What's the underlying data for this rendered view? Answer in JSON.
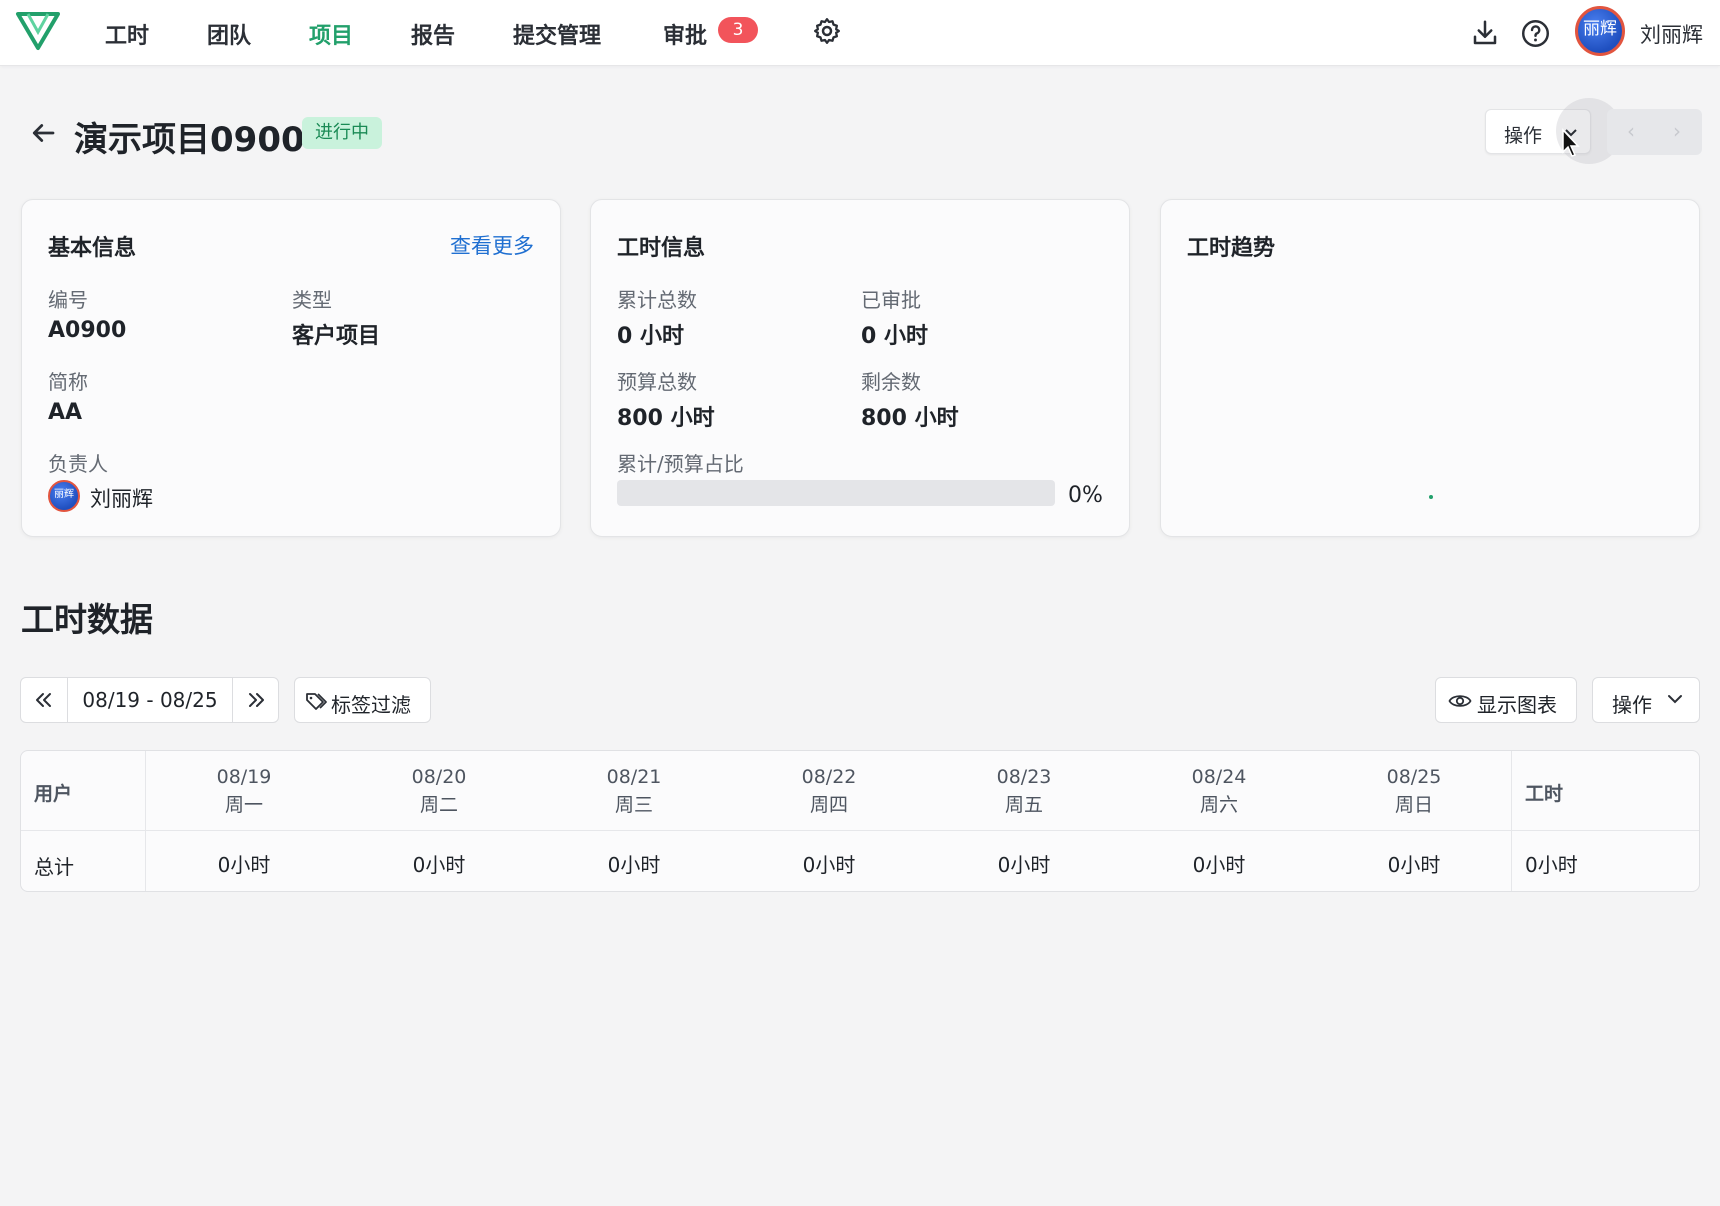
{
  "nav": {
    "items": [
      "工时",
      "团队",
      "项目",
      "报告",
      "提交管理",
      "审批"
    ],
    "active_index": 2,
    "approval_badge": "3",
    "user": {
      "avatar_text": "丽辉",
      "name": "刘丽辉"
    },
    "icons": [
      "logo",
      "settings-icon",
      "download-icon",
      "help-icon"
    ]
  },
  "header": {
    "title": "演示项目0900",
    "status": "进行中",
    "operation_label": "操作"
  },
  "basic_info": {
    "title": "基本信息",
    "see_more": "查看更多",
    "code_label": "编号",
    "code_value": "A0900",
    "type_label": "类型",
    "type_value": "客户项目",
    "short_label": "简称",
    "short_value": "AA",
    "owner_label": "负责人",
    "owner_avatar_text": "丽辉",
    "owner_name": "刘丽辉"
  },
  "hours_info": {
    "title": "工时信息",
    "total_label": "累计总数",
    "total_value": "0 小时",
    "approved_label": "已审批",
    "approved_value": "0 小时",
    "budget_label": "预算总数",
    "budget_value": "800 小时",
    "remaining_label": "剩余数",
    "remaining_value": "800 小时",
    "ratio_label": "累计/预算占比",
    "ratio_value": "0%",
    "ratio_fraction": 0
  },
  "trend": {
    "title": "工时趋势"
  },
  "section": {
    "title": "工时数据",
    "date_range": "08/19 - 08/25",
    "tag_filter": "标签过滤",
    "show_chart": "显示图表",
    "operation_label": "操作"
  },
  "table": {
    "user_header": "用户",
    "hours_header": "工时",
    "days": [
      {
        "date": "08/19",
        "weekday": "周一",
        "value": "0小时"
      },
      {
        "date": "08/20",
        "weekday": "周二",
        "value": "0小时"
      },
      {
        "date": "08/21",
        "weekday": "周三",
        "value": "0小时"
      },
      {
        "date": "08/22",
        "weekday": "周四",
        "value": "0小时"
      },
      {
        "date": "08/23",
        "weekday": "周五",
        "value": "0小时"
      },
      {
        "date": "08/24",
        "weekday": "周六",
        "value": "0小时"
      },
      {
        "date": "08/25",
        "weekday": "周日",
        "value": "0小时"
      }
    ],
    "total_row_label": "总计",
    "total_hours": "0小时"
  },
  "colors": {
    "accent": "#22a06b",
    "link": "#1f6fd1",
    "badge": "#f2545b",
    "status_bg": "#c9f2dc"
  }
}
